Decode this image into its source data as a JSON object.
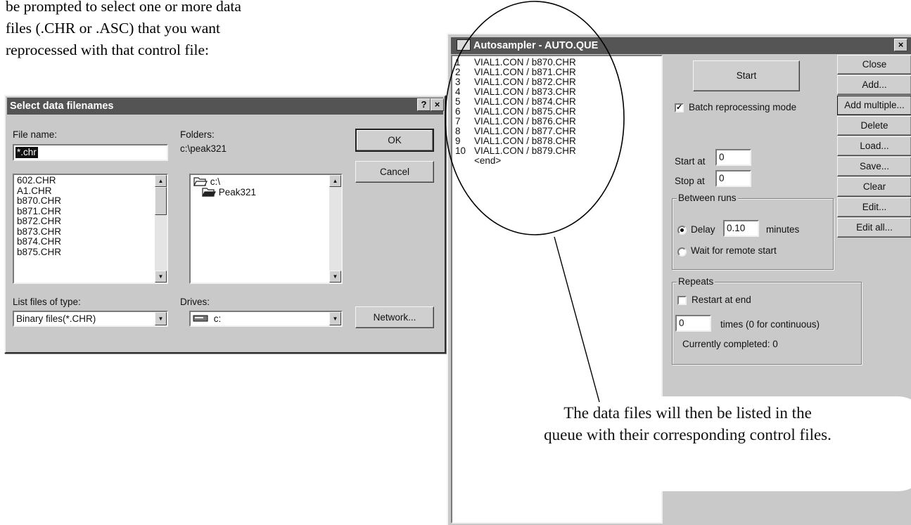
{
  "intro": {
    "line1": "be prompted to select one or more data",
    "line2": "files (.CHR or .ASC) that you want",
    "line3": "reprocessed with that control file:"
  },
  "select_dialog": {
    "title": "Select data filenames",
    "help_button": "?",
    "close_button": "×",
    "file_name_label": "File name:",
    "file_name_value": "*.chr",
    "files": [
      "602.CHR",
      "A1.CHR",
      "b870.CHR",
      "b871.CHR",
      "b872.CHR",
      "b873.CHR",
      "b874.CHR",
      "b875.CHR"
    ],
    "folders_label": "Folders:",
    "current_folder": "c:\\peak321",
    "folder_tree": [
      "c:\\",
      "Peak321"
    ],
    "type_label": "List files of type:",
    "type_value": "Binary files(*.CHR)",
    "drives_label": "Drives:",
    "drive_value": "c:",
    "ok_button": "OK",
    "cancel_button": "Cancel",
    "network_button": "Network..."
  },
  "autosampler": {
    "title": "Autosampler - AUTO.QUE",
    "close_button": "×",
    "queue": [
      {
        "num": "1",
        "entry": "VIAL1.CON / b870.CHR"
      },
      {
        "num": "2",
        "entry": "VIAL1.CON / b871.CHR"
      },
      {
        "num": "3",
        "entry": "VIAL1.CON / b872.CHR"
      },
      {
        "num": "4",
        "entry": "VIAL1.CON / b873.CHR"
      },
      {
        "num": "5",
        "entry": "VIAL1.CON / b874.CHR"
      },
      {
        "num": "6",
        "entry": "VIAL1.CON / b875.CHR"
      },
      {
        "num": "7",
        "entry": "VIAL1.CON / b876.CHR"
      },
      {
        "num": "8",
        "entry": "VIAL1.CON / b877.CHR"
      },
      {
        "num": "9",
        "entry": "VIAL1.CON / b878.CHR"
      },
      {
        "num": "10",
        "entry": "VIAL1.CON / b879.CHR"
      }
    ],
    "queue_end": "<end>",
    "start_button": "Start",
    "batch_label": "Batch reprocessing mode",
    "batch_checked": true,
    "start_at_label": "Start at",
    "start_at_value": "0",
    "stop_at_label": "Stop at",
    "stop_at_value": "0",
    "between_runs_title": "Between runs",
    "delay_label": "Delay",
    "delay_value": "0.10",
    "delay_units": "minutes",
    "remote_label": "Wait for remote start",
    "repeats_title": "Repeats",
    "restart_label": "Restart at end",
    "times_value": "0",
    "times_label": "times (0 for continuous)",
    "completed_label": "Currently completed: 0",
    "side_buttons": [
      "Close",
      "Add...",
      "Add multiple...",
      "Delete",
      "Load...",
      "Save...",
      "Clear",
      "Edit...",
      "Edit all..."
    ]
  },
  "callout": {
    "line1": "The data files will then be listed in the",
    "line2": "queue with their corresponding control files."
  }
}
